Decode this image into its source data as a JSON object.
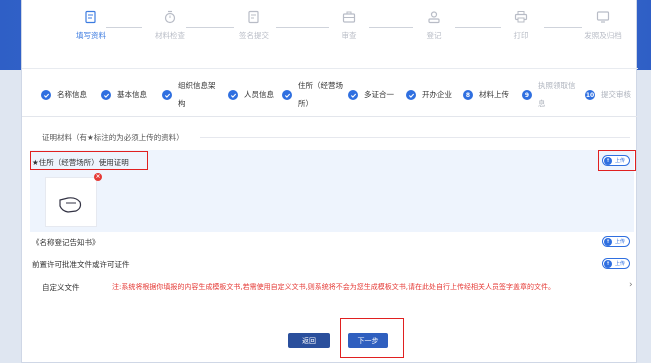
{
  "colors": {
    "accent": "#2f6fe0",
    "active_step": "#3c7be0",
    "required": "#e53935",
    "header_band": "#3a74d6"
  },
  "steps": [
    {
      "label": "填写资料",
      "icon": "edit-icon",
      "active": true
    },
    {
      "label": "材料检查",
      "icon": "timer-icon",
      "active": false
    },
    {
      "label": "签名提交",
      "icon": "sign-doc-icon",
      "active": false
    },
    {
      "label": "审查",
      "icon": "briefcase-icon",
      "active": false
    },
    {
      "label": "登记",
      "icon": "register-icon",
      "active": false
    },
    {
      "label": "打印",
      "icon": "printer-icon",
      "active": false
    },
    {
      "label": "发照及归档",
      "icon": "monitor-icon",
      "active": false
    }
  ],
  "subtabs": [
    {
      "label": "名称信息",
      "status": "done"
    },
    {
      "label": "基本信息",
      "status": "done"
    },
    {
      "label": "组织信息架构",
      "status": "done"
    },
    {
      "label": "人员信息",
      "status": "done"
    },
    {
      "label": "住所（经营场所）",
      "status": "done"
    },
    {
      "label": "多证合一",
      "status": "done"
    },
    {
      "label": "开办企业",
      "status": "done"
    },
    {
      "label": "材料上传",
      "status": "current",
      "number": "8"
    },
    {
      "label": "执照领取信息",
      "status": "pending",
      "number": "9"
    },
    {
      "label": "提交审核",
      "status": "pending",
      "number": "10"
    }
  ],
  "section": {
    "title": "证明材料（有★标注的为必须上传的资料）",
    "items": [
      {
        "label": "★住所（经营场所）使用证明",
        "upload_label": "上传",
        "has_file": true
      },
      {
        "label": "《名称登记告知书》",
        "upload_label": "上传",
        "has_file": false
      },
      {
        "label": "前置许可批准文件或许可证件",
        "upload_label": "上传",
        "has_file": false
      }
    ],
    "custom": {
      "label": "自定义文件",
      "note": "注:系统将根据你填报的内容生成模板文书,若需使用自定义文书,则系统将不会为您生成模板文书,请在此处自行上传经相关人员签字盖章的文件。"
    }
  },
  "buttons": {
    "back": "返回",
    "next": "下一步"
  }
}
